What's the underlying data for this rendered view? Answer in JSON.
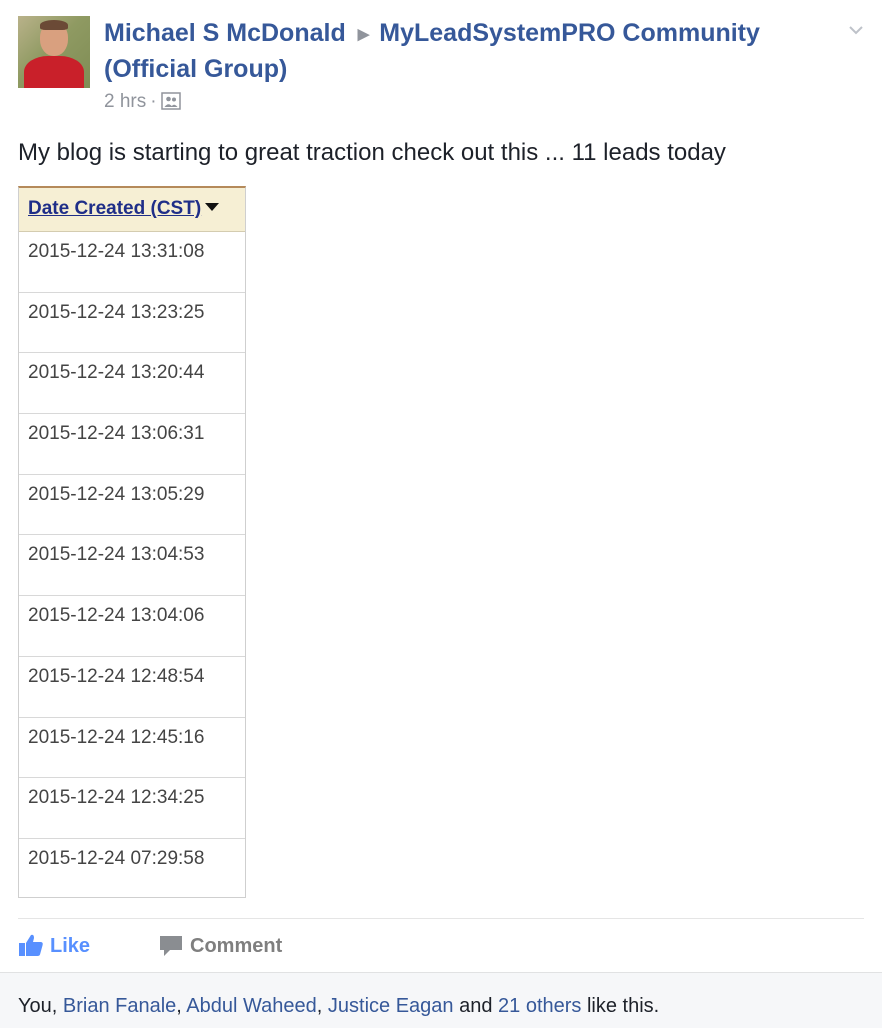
{
  "post": {
    "author": "Michael S McDonald",
    "group": "MyLeadSystemPRO Community (Official Group)",
    "time": "2 hrs",
    "text": "My blog is starting to great traction check out this ... 11 leads today"
  },
  "leads_table": {
    "header": "Date Created (CST)",
    "rows": [
      "2015-12-24 13:31:08",
      "2015-12-24 13:23:25",
      "2015-12-24 13:20:44",
      "2015-12-24 13:06:31",
      "2015-12-24 13:05:29",
      "2015-12-24 13:04:53",
      "2015-12-24 13:04:06",
      "2015-12-24 12:48:54",
      "2015-12-24 12:45:16",
      "2015-12-24 12:34:25",
      "2015-12-24 07:29:58"
    ]
  },
  "actions": {
    "like_label": "Like",
    "comment_label": "Comment"
  },
  "likes": {
    "you": "You",
    "names": [
      "Brian Fanale",
      "Abdul Waheed",
      "Justice Eagan"
    ],
    "others": "21 others",
    "conj": "and",
    "suffix": "like this."
  },
  "icons": {
    "header_arrow": "triangle-right-icon",
    "options": "chevron-down-icon",
    "audience": "group-icon",
    "like": "thumbs-up-icon",
    "comment": "speech-bubble-icon",
    "sort": "caret-down-icon"
  },
  "colors": {
    "link": "#365899",
    "like_blue": "#5890ff",
    "muted": "#90949c",
    "table_header_bg": "#f6efd4",
    "table_header_text": "#1f2e88"
  }
}
